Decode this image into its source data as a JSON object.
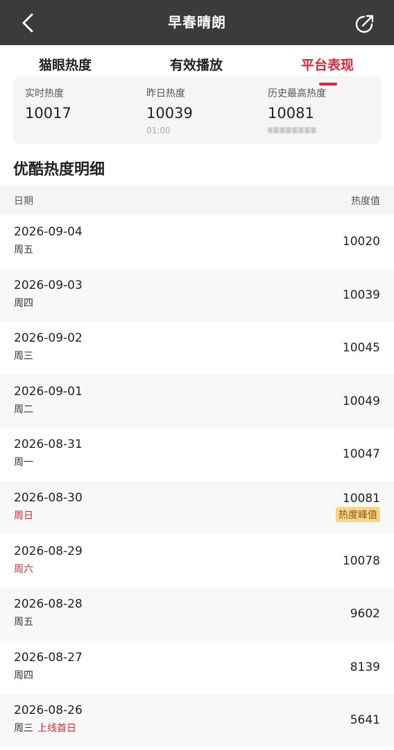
{
  "header": {
    "title": "早春晴朗",
    "back_icon": "chevron-left-icon",
    "share_icon": "share-icon"
  },
  "tabs": [
    {
      "label": "猫眼热度",
      "active": false
    },
    {
      "label": "有效播放",
      "active": false
    },
    {
      "label": "平台表现",
      "active": true
    }
  ],
  "stats": {
    "realtime": {
      "label": "实时热度",
      "value": "10017"
    },
    "yesterday": {
      "label": "昨日热度",
      "value": "10039",
      "sub": "01:00"
    },
    "history_max": {
      "label": "历史最高热度",
      "value": "10081"
    }
  },
  "section": {
    "title": "优酷热度明细"
  },
  "table": {
    "col_date": "日期",
    "col_value": "热度值",
    "rows": [
      {
        "date": "2026-09-04",
        "weekday": "周五",
        "value": "10020"
      },
      {
        "date": "2026-09-03",
        "weekday": "周四",
        "value": "10039"
      },
      {
        "date": "2026-09-02",
        "weekday": "周三",
        "value": "10045"
      },
      {
        "date": "2026-09-01",
        "weekday": "周二",
        "value": "10049"
      },
      {
        "date": "2026-08-31",
        "weekday": "周一",
        "value": "10047"
      },
      {
        "date": "2026-08-30",
        "weekday": "周日",
        "value": "10081",
        "badge": "热度峰值"
      },
      {
        "date": "2026-08-29",
        "weekday": "周六",
        "value": "10078"
      },
      {
        "date": "2026-08-28",
        "weekday": "周五",
        "value": "9602"
      },
      {
        "date": "2026-08-27",
        "weekday": "周四",
        "value": "8139"
      },
      {
        "date": "2026-08-26",
        "weekday": "周三",
        "extra": "上线首日",
        "value": "5641"
      }
    ]
  },
  "colors": {
    "accent": "#e0263a",
    "header_bg": "#3b3b3b",
    "badge_bg": "#f8d58d"
  }
}
